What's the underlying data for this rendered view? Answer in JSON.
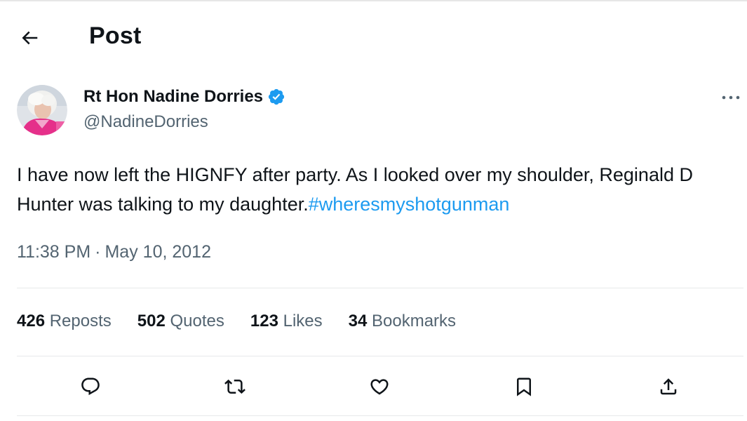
{
  "header": {
    "title": "Post",
    "back_icon": "arrow-left-icon"
  },
  "author": {
    "name": "Rt Hon Nadine Dorries",
    "handle": "@NadineDorries",
    "verified": true,
    "verified_color": "#1d9bf0"
  },
  "tweet": {
    "text": "I have now left the HIGNFY after party. As I looked over my shoulder, Reginald D Hunter was talking to my daughter.",
    "hashtag": "#wheresmyshotgunman",
    "hashtag_color": "#1d9bf0",
    "time": "11:38 PM",
    "separator": "·",
    "date": "May 10, 2012"
  },
  "stats": [
    {
      "count": "426",
      "label": "Reposts"
    },
    {
      "count": "502",
      "label": "Quotes"
    },
    {
      "count": "123",
      "label": "Likes"
    },
    {
      "count": "34",
      "label": "Bookmarks"
    }
  ],
  "actions": [
    {
      "icon": "reply-icon"
    },
    {
      "icon": "repost-icon"
    },
    {
      "icon": "like-icon"
    },
    {
      "icon": "bookmark-icon"
    },
    {
      "icon": "share-icon"
    }
  ],
  "colors": {
    "text": "#0f1419",
    "secondary": "#536471",
    "divider": "#e7e9ea"
  }
}
